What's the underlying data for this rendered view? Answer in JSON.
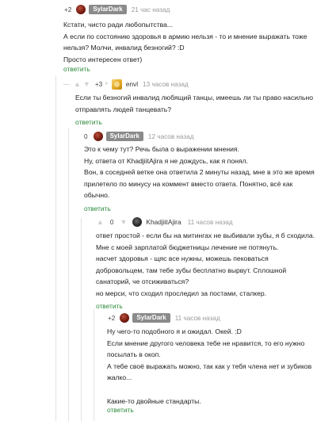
{
  "comments": [
    {
      "score": "+2",
      "author": "SylarDark",
      "time": "21 час назад",
      "lines": [
        "Кстати, чисто ради любопытства...",
        "А если по состоянию здоровья в армию нельзя - то и мнение выражать тоже",
        "нельзя? Молчи, инвалид безногий? :D",
        "Просто интересен ответ)"
      ],
      "reply": "ответить"
    },
    {
      "score": "+3",
      "author": "envl",
      "time": "13 часов назад",
      "lines": [
        "Если ты безногий инвалид любящий танцы, имеешь ли ты право насильно",
        "отправлять людей танцевать?"
      ],
      "reply": "ответить"
    },
    {
      "score": "0",
      "author": "SylarDark",
      "time": "12 часов назад",
      "lines": [
        "Это к чему тут? Речь была о выражении мнения.",
        "Ну, ответа от KhadjiitAjira я не дождусь, как я понял.",
        "Вон, в соседней ветке она ответила 2 минуты назад, мне в это же время",
        "прилетело по минусу на коммент вместо ответа. Понятно, всё как",
        "обычно."
      ],
      "reply": "ответить"
    },
    {
      "score": "0",
      "author": "KhadjiitAjira",
      "time": "11 часов назад",
      "lines": [
        "ответ простой - если бы на митингах не выбивали зубы, я б сходила.",
        "Мне с моей зарплатой бюджетницы лечение не потянуть.",
        "насчет здоровья - щяс все нужны, можешь пековаться",
        "добровольцем, там тебе зубы бесплатно вырвут. Сплошной",
        "санаторий, че отсиживаться?",
        "но мерси, что сходил проследил за постами, сталкер."
      ],
      "reply": "ответить"
    },
    {
      "score": "+2",
      "author": "SylarDark",
      "time": "11 часов назад",
      "lines": [
        "Ну чего-то подобного я и ожидал. Окей. :D",
        "Если мнение другого человека тебе не нравится, то его нужно",
        "посылать в окоп.",
        "А тебе своё выражать можно, так как у тебя члена нет и зубиков",
        "жалко...",
        "",
        "Какие-то двойные стандарты."
      ],
      "reply": "ответить"
    }
  ],
  "icons": {
    "upvote": "arrow-up-icon",
    "downvote": "arrow-down-icon",
    "avatar_envl": "avatar-icon"
  },
  "colors": {
    "reply_link": "#2c8a3c",
    "badge_bg": "#8a8a8a",
    "time_text": "#9a9a9a"
  }
}
